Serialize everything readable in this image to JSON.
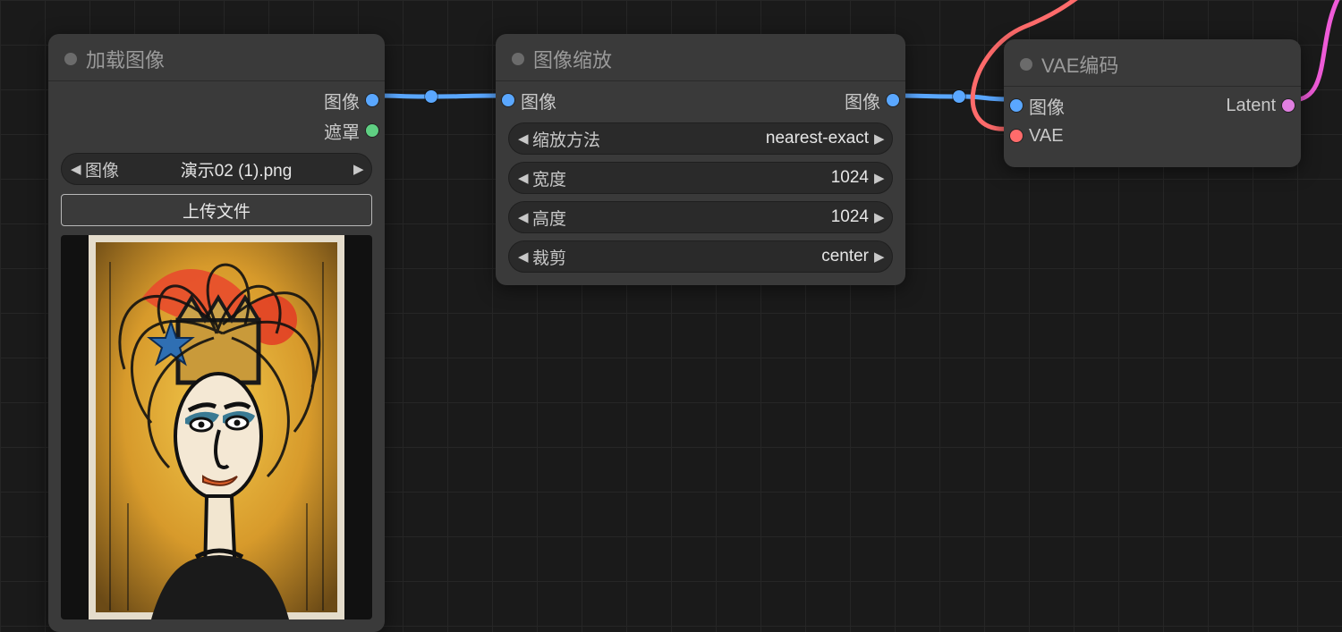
{
  "nodes": {
    "load": {
      "title": "加载图像",
      "outputs": {
        "image": "图像",
        "mask": "遮罩"
      },
      "widget_image_label": "图像",
      "widget_image_value": "演示02 (1).png",
      "upload_button": "上传文件"
    },
    "scale": {
      "title": "图像缩放",
      "input_image": "图像",
      "output_image": "图像",
      "widgets": {
        "method_label": "缩放方法",
        "method_value": "nearest-exact",
        "width_label": "宽度",
        "width_value": "1024",
        "height_label": "高度",
        "height_value": "1024",
        "crop_label": "裁剪",
        "crop_value": "center"
      }
    },
    "vae": {
      "title": "VAE编码",
      "inputs": {
        "image": "图像",
        "vae": "VAE"
      },
      "output_latent": "Latent"
    }
  }
}
